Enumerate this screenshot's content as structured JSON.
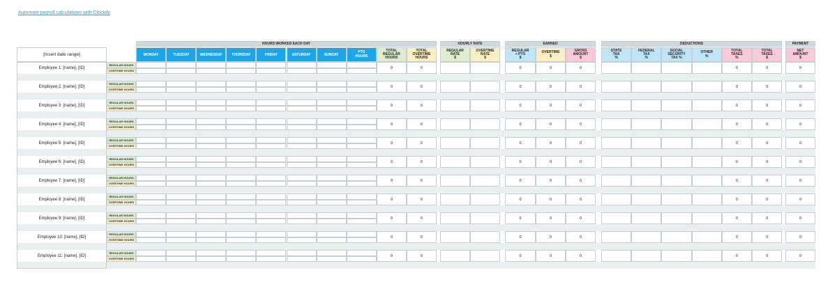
{
  "top_link": "Automate payroll calculations with Clockify",
  "date_range": "[Insert date range]",
  "row_labels": {
    "regular": "REGULAR HOURS",
    "overtime": "OVERTIME HOURS"
  },
  "groups": [
    {
      "label": "HOURS WORKED EACH DAY"
    },
    {
      "label": "HOURLY RATE"
    },
    {
      "label": "EARNED"
    },
    {
      "label": "DEDUCTIONS"
    },
    {
      "label": "PAYMENT"
    }
  ],
  "columns": [
    {
      "label": "MONDAY",
      "group": 0,
      "value": ""
    },
    {
      "label": "TUESDAY",
      "group": 0,
      "value": ""
    },
    {
      "label": "WEDNESDAY",
      "group": 0,
      "value": ""
    },
    {
      "label": "THURSDAY",
      "group": 0,
      "value": ""
    },
    {
      "label": "FRIDAY",
      "group": 0,
      "value": ""
    },
    {
      "label": "SATURDAY",
      "group": 0,
      "value": ""
    },
    {
      "label": "SUNDAY",
      "group": 0,
      "value": ""
    },
    {
      "label": "PTO\nHOURS",
      "group": 0,
      "value": ""
    },
    {
      "label": "TOTAL\nREGULAR\nHOURS",
      "group": 0,
      "value": "0"
    },
    {
      "label": "TOTAL\nOVERTIME\nHOURS",
      "group": 0,
      "value": "0"
    },
    {
      "label": "REGULAR\nRATE\n$",
      "group": 1,
      "value": ""
    },
    {
      "label": "OVERTIME\nRATE\n$",
      "group": 1,
      "value": ""
    },
    {
      "label": "REGULAR\n+ PTO\n$",
      "group": 2,
      "value": "0"
    },
    {
      "label": "OVERTIME\n$",
      "group": 2,
      "value": "0"
    },
    {
      "label": "GROSS\nAMOUNT\n$",
      "group": 2,
      "value": "0"
    },
    {
      "label": "STATE\nTAX\n%",
      "group": 3,
      "value": ""
    },
    {
      "label": "FEDERAL\nTAX\n%",
      "group": 3,
      "value": ""
    },
    {
      "label": "SOCIAL\nSECURITY\nTAX %",
      "group": 3,
      "value": ""
    },
    {
      "label": "OTHER\n%",
      "group": 3,
      "value": ""
    },
    {
      "label": "TOTAL\nTAXES\n%",
      "group": 3,
      "value": "0"
    },
    {
      "label": "TOTAL\nTAXES\n$",
      "group": 3,
      "value": "0"
    },
    {
      "label": "NET\nAMOUNT\n$",
      "group": 4,
      "value": "0"
    }
  ],
  "employees": [
    "Employee 1: [name], [ID]",
    "Employee 2: [name], [ID]",
    "Employee 3: [name], [ID]",
    "Employee 4: [name], [ID]",
    "Employee 5: [name], [ID]",
    "Employee 6: [name], [ID]",
    "Employee 7: [name], [ID]",
    "Employee 8: [name], [ID]",
    "Employee 9: [name], [ID]",
    "Employee 10: [name], [ID]",
    "Employee 11: [name], [ID]"
  ],
  "colors": {
    "group_header_bg": "#cfd8dc",
    "day_header_bg": "#1aa6e8",
    "totals_header_bg": "#dfeccd",
    "overtime_header_bg": "#fbeec2",
    "earned_regular_bg": "#fbeec2",
    "gross_amount_bg": "#f9c9da",
    "deduction_header_bg": "#bfe3f7",
    "total_taxes_bg": "#f9c9da",
    "net_amount_bg": "#f9c9da",
    "regular_tag_bg": "#dfeccd",
    "overtime_tag_bg": "#fbeec2",
    "separator_bg": "#e9eff1",
    "border": "#c5cdd1",
    "link": "#1fa3dc"
  }
}
